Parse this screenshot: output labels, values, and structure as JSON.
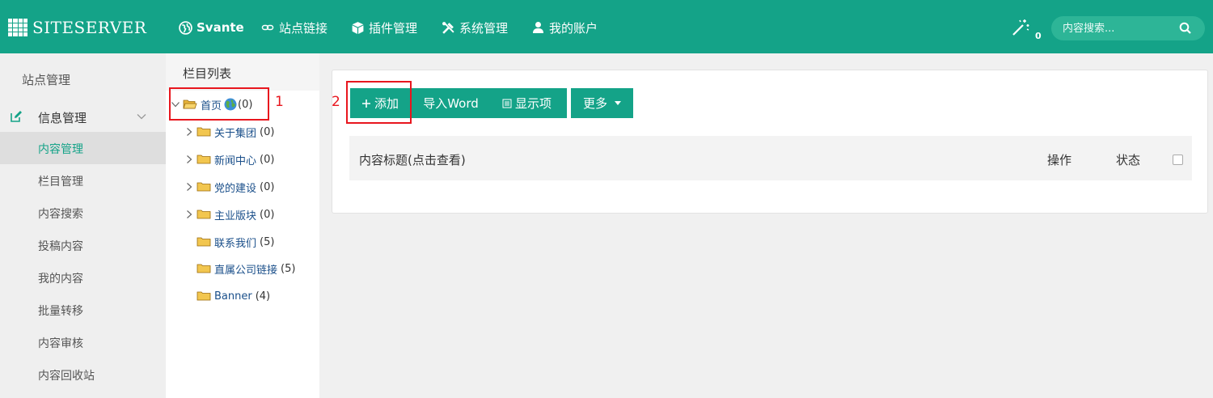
{
  "app": {
    "logo_text": "SITESERVER"
  },
  "topnav": {
    "items": [
      {
        "label": "Svante",
        "icon": "globe-icon"
      },
      {
        "label": "站点链接",
        "icon": "link-icon"
      },
      {
        "label": "插件管理",
        "icon": "cube-icon"
      },
      {
        "label": "系统管理",
        "icon": "tools-icon"
      },
      {
        "label": "我的账户",
        "icon": "user-icon"
      }
    ],
    "notification_count": "0",
    "search_placeholder": "内容搜索..."
  },
  "sidebar": {
    "title": "站点管理",
    "group_label": "信息管理",
    "items": [
      {
        "label": "内容管理",
        "active": true
      },
      {
        "label": "栏目管理"
      },
      {
        "label": "内容搜索"
      },
      {
        "label": "投稿内容"
      },
      {
        "label": "我的内容"
      },
      {
        "label": "批量转移"
      },
      {
        "label": "内容审核"
      },
      {
        "label": "内容回收站"
      }
    ]
  },
  "tree": {
    "header": "栏目列表",
    "root": {
      "name": "首页",
      "count": "(0)"
    },
    "nodes": [
      {
        "name": "关于集团",
        "count": "(0)"
      },
      {
        "name": "新闻中心",
        "count": "(0)"
      },
      {
        "name": "党的建设",
        "count": "(0)"
      },
      {
        "name": "主业版块",
        "count": "(0)"
      },
      {
        "name": "联系我们",
        "count": "(5)"
      },
      {
        "name": "直属公司链接",
        "count": "(5)"
      },
      {
        "name": "Banner",
        "count": "(4)"
      }
    ]
  },
  "toolbar": {
    "add_label": "添加",
    "import_label": "导入Word",
    "display_label": "显示项",
    "more_label": "更多"
  },
  "table": {
    "col_title": "内容标题(点击查看)",
    "col_action": "操作",
    "col_status": "状态"
  },
  "annotations": {
    "label_1": "1",
    "label_2": "2"
  },
  "colors": {
    "brand": "#14a388",
    "annotation": "#e8161e",
    "link": "#1a4f8a"
  }
}
